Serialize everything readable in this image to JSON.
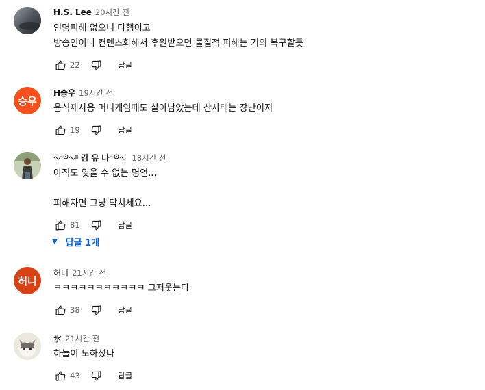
{
  "comments": [
    {
      "author": "H.S. Lee",
      "time": "20시간 전",
      "text": "인명피해 없으니 다행이고\n방송인이니 컨텐츠화해서 후원받으면 물질적 피해는 거의 복구할듯",
      "likes": "22",
      "reply_label": "답글",
      "avatar": {
        "type": "image",
        "description": "dark blurry photo"
      }
    },
    {
      "author": "H승우",
      "time": "19시간 전",
      "text": "음식재사용 머니게임때도 살아남았는데 산사태는 장난이지",
      "likes": "19",
      "reply_label": "답글",
      "avatar": {
        "type": "initials",
        "initials": "승우",
        "color": "#f4511e"
      }
    },
    {
      "author_parts": [
        "김 유 나"
      ],
      "time": "18시간 전",
      "text": "아직도 잊을 수 없는 명언...\n\n피해자면 그냥 닥치세요...",
      "likes": "81",
      "reply_label": "답글",
      "replies_toggle": "답글 1개",
      "avatar": {
        "type": "image",
        "description": "person standing outdoors"
      }
    },
    {
      "author": "허니",
      "time": "21시간 전",
      "text": "ㅋㅋㅋㅋㅋㅋㅋㅋㅋㅋㅋ 그저웃는다",
      "likes": "38",
      "reply_label": "답글",
      "avatar": {
        "type": "initials",
        "initials": "허니",
        "color": "#d84315"
      }
    },
    {
      "author": "氷",
      "time": "21시간 전",
      "text": "하늘이 노하셨다",
      "likes": "43",
      "reply_label": "답글",
      "avatar": {
        "type": "image",
        "description": "white and grey cat"
      }
    }
  ],
  "icons": {
    "like": "thumb-up-icon",
    "dislike": "thumb-down-icon",
    "caret": "chevron-down-icon"
  },
  "colors": {
    "link": "#065fd4",
    "meta": "#606060",
    "text": "#0f0f0f"
  }
}
